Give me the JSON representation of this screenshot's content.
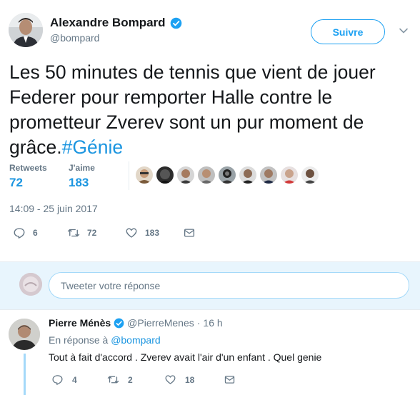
{
  "tweet": {
    "author_name": "Alexandre Bompard",
    "author_handle": "@bompard",
    "follow_label": "Suivre",
    "text": "Les 50 minutes de tennis que vient de jouer Federer pour remporter Halle contre le prometteur Zverev sont un pur moment de grâce.",
    "hashtag": "#Génie",
    "stats": {
      "retweets_label": "Retweets",
      "retweets_value": "72",
      "likes_label": "J'aime",
      "likes_value": "183"
    },
    "timestamp": "14:09 - 25 juin 2017",
    "actions": {
      "replies": "6",
      "retweets": "72",
      "likes": "183"
    }
  },
  "reply_box": {
    "placeholder": "Tweeter votre réponse"
  },
  "reply_tweet": {
    "author_name": "Pierre Ménès",
    "author_handle": "@PierreMenes",
    "separator": "·",
    "time": "16 h",
    "context_prefix": "En réponse à",
    "context_mention": "@bompard",
    "text": "Tout à fait d'accord . Zverev avait l'air d'un enfant . Quel genie",
    "actions": {
      "replies": "4",
      "retweets": "2",
      "likes": "18"
    }
  },
  "colors": {
    "accent": "#1da1f2",
    "link": "#1b95e0",
    "muted": "#657786",
    "reply_bg": "#e8f5fd"
  },
  "icons": [
    "verified-icon",
    "caret-down-icon",
    "reply-icon",
    "retweet-icon",
    "heart-icon",
    "dm-icon"
  ]
}
